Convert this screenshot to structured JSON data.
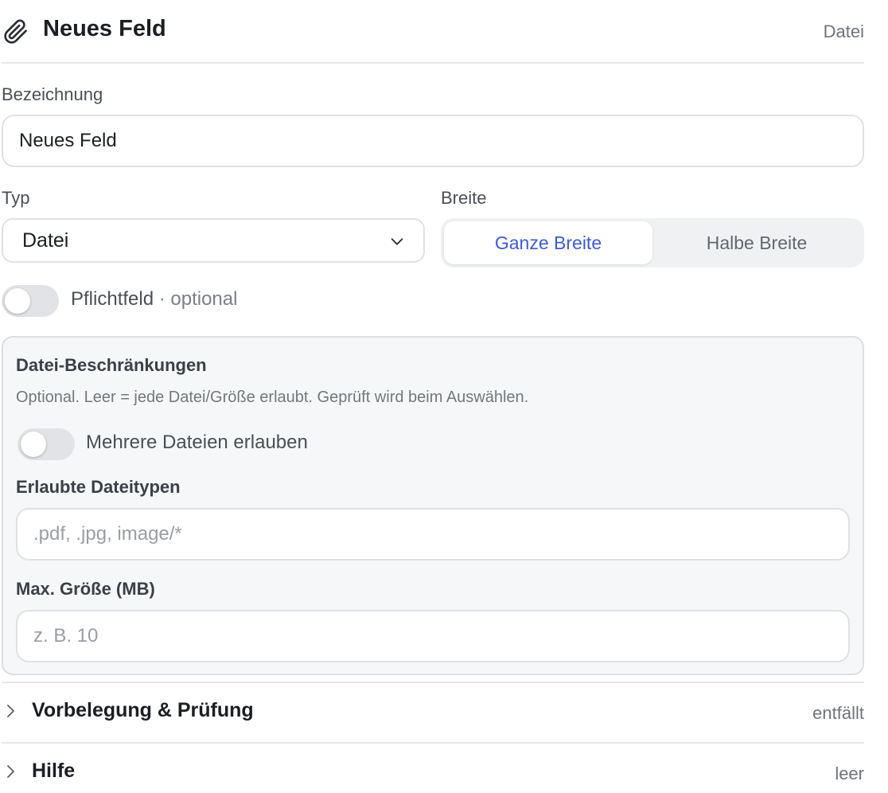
{
  "header": {
    "icon": "paperclip-icon",
    "title": "Neues Feld",
    "type_label": "Datei"
  },
  "bezeichnung": {
    "label": "Bezeichnung",
    "value": "Neues Feld"
  },
  "typ": {
    "label": "Typ",
    "selected": "Datei",
    "icon": "chevron-down-icon"
  },
  "breite": {
    "label": "Breite",
    "options": [
      "Ganze Breite",
      "Halbe Breite"
    ],
    "selected": "Ganze Breite"
  },
  "pflichtfeld": {
    "label": "Pflichtfeld",
    "suffix": " · optional",
    "on": false
  },
  "restrictions": {
    "title": "Datei-Beschränkungen",
    "description": "Optional. Leer = jede Datei/Größe erlaubt. Geprüft wird beim Auswählen.",
    "multiple": {
      "label": "Mehrere Dateien erlauben",
      "on": false
    },
    "types": {
      "label": "Erlaubte Dateitypen",
      "placeholder": ".pdf, .jpg, image/*"
    },
    "max_size": {
      "label": "Max. Größe (MB)",
      "placeholder": "z. B. 10"
    }
  },
  "sections": [
    {
      "title": "Vorbelegung & Prüfung",
      "value": "entfällt",
      "icon": "chevron-right-icon"
    },
    {
      "title": "Hilfe",
      "value": "leer",
      "icon": "chevron-right-icon"
    }
  ],
  "colors": {
    "accent": "#3d5bd6",
    "panel_bg": "#f6f7f9",
    "toggle_off": "#e2e3e6"
  }
}
